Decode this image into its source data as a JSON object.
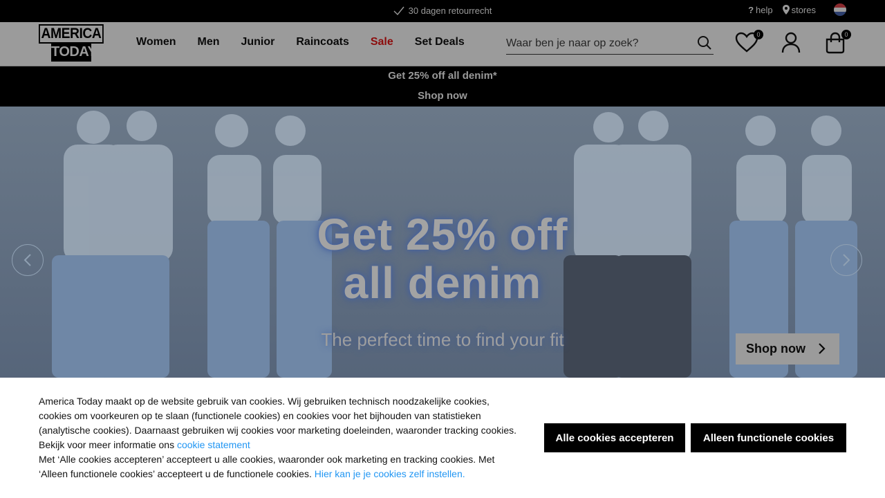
{
  "topbar": {
    "usp": "30 dagen retourrecht",
    "help": "help",
    "stores": "stores",
    "flag_colors": [
      "#ae1c28",
      "#ffffff",
      "#21468b"
    ]
  },
  "header": {
    "logo_line1": "AMERICA",
    "logo_line2": "TODAY",
    "nav": [
      "Women",
      "Men",
      "Junior",
      "Raincoats",
      "Sale",
      "Set Deals"
    ],
    "search_placeholder": "Waar ben je naar op zoek?",
    "wishlist_count": "0",
    "cart_count": "0"
  },
  "promo": {
    "title": "Get 25% off all denim*",
    "link": "Shop now"
  },
  "hero": {
    "headline_line1": "Get 25% off",
    "headline_line2": "all denim",
    "subline": "The perfect time to find your fit",
    "cta": "Shop now"
  },
  "cookie": {
    "text1": "America Today maakt op de website gebruik van cookies. Wij gebruiken technisch noodzakelijke cookies, cookies om voorkeuren op te slaan (functionele cookies) en cookies voor het bijhouden van statistieken (analytische cookies). Daarnaast gebruiken wij cookies voor marketing doeleinden, waaronder tracking cookies. Bekijk voor meer informatie ons ",
    "link1": "cookie statement",
    "text2": "Met ‘Alle cookies accepteren’ accepteert u alle cookies, waaronder ook marketing en tracking cookies. Met ‘Alleen functionele cookies’ accepteert u de functionele cookies. ",
    "link2": "Hier kan je je cookies zelf instellen.",
    "accept_all": "Alle cookies accepteren",
    "functional_only": "Alleen functionele cookies"
  }
}
